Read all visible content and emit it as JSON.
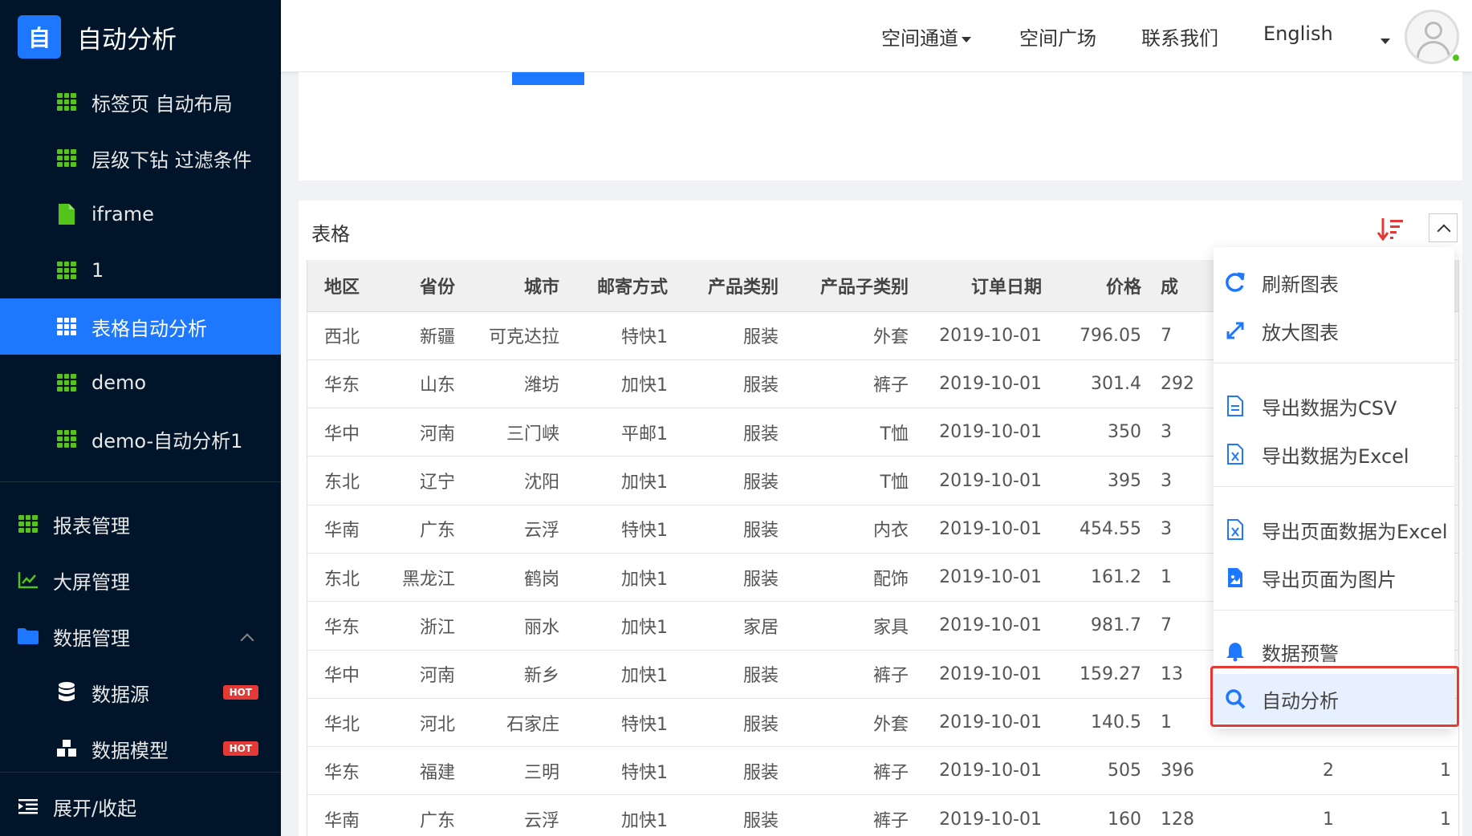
{
  "logo": {
    "glyph": "自",
    "title": "自动分析"
  },
  "sidebar": {
    "sub_items": [
      {
        "label": "标签页 自动布局",
        "icon": "grid-icon"
      },
      {
        "label": "层级下钻 过滤条件",
        "icon": "grid-icon"
      },
      {
        "label": "iframe",
        "icon": "file-icon"
      },
      {
        "label": "1",
        "icon": "grid-icon"
      },
      {
        "label": "表格自动分析",
        "icon": "grid-icon",
        "active": true
      },
      {
        "label": "demo",
        "icon": "grid-icon"
      },
      {
        "label": "demo-自动分析1",
        "icon": "grid-icon"
      }
    ],
    "top_items": [
      {
        "label": "报表管理",
        "icon": "grid-icon"
      },
      {
        "label": "大屏管理",
        "icon": "chart-line-icon"
      },
      {
        "label": "数据管理",
        "icon": "folder-icon"
      }
    ],
    "data_sub": [
      {
        "label": "数据源",
        "icon": "database-icon",
        "badge": "HOT"
      },
      {
        "label": "数据模型",
        "icon": "cubes-icon",
        "badge": "HOT"
      }
    ],
    "toggle": "展开/收起"
  },
  "header": {
    "nav": [
      "空间通道",
      "空间广场",
      "联系我们",
      "English"
    ]
  },
  "card": {
    "title": "表格"
  },
  "table": {
    "columns": [
      "地区",
      "省份",
      "城市",
      "邮寄方式",
      "产品类别",
      "产品子类别",
      "订单日期",
      "价格",
      "成",
      "",
      ""
    ],
    "rows": [
      [
        "西北",
        "新疆",
        "可克达拉",
        "特快1",
        "服装",
        "外套",
        "2019-10-01",
        "796.05",
        "7",
        "",
        ""
      ],
      [
        "华东",
        "山东",
        "潍坊",
        "加快1",
        "服装",
        "裤子",
        "2019-10-01",
        "301.4",
        "292",
        "",
        ""
      ],
      [
        "华中",
        "河南",
        "三门峡",
        "平邮1",
        "服装",
        "T恤",
        "2019-10-01",
        "350",
        "3",
        "",
        ""
      ],
      [
        "东北",
        "辽宁",
        "沈阳",
        "加快1",
        "服装",
        "T恤",
        "2019-10-01",
        "395",
        "3",
        "",
        ""
      ],
      [
        "华南",
        "广东",
        "云浮",
        "特快1",
        "服装",
        "内衣",
        "2019-10-01",
        "454.55",
        "3",
        "",
        ""
      ],
      [
        "东北",
        "黑龙江",
        "鹤岗",
        "加快1",
        "服装",
        "配饰",
        "2019-10-01",
        "161.2",
        "1",
        "",
        ""
      ],
      [
        "华东",
        "浙江",
        "丽水",
        "加快1",
        "家居",
        "家具",
        "2019-10-01",
        "981.7",
        "7",
        "",
        ""
      ],
      [
        "华中",
        "河南",
        "新乡",
        "加快1",
        "服装",
        "裤子",
        "2019-10-01",
        "159.27",
        "13",
        "",
        ""
      ],
      [
        "华北",
        "河北",
        "石家庄",
        "特快1",
        "服装",
        "外套",
        "2019-10-01",
        "140.5",
        "1",
        "",
        ""
      ],
      [
        "华东",
        "福建",
        "三明",
        "特快1",
        "服装",
        "裤子",
        "2019-10-01",
        "505",
        "396",
        "2",
        "1"
      ],
      [
        "华南",
        "广东",
        "云浮",
        "加快1",
        "服装",
        "裤子",
        "2019-10-01",
        "160",
        "128",
        "1",
        "1"
      ]
    ]
  },
  "dropdown": {
    "items": [
      {
        "label": "刷新图表",
        "icon": "refresh-icon"
      },
      {
        "label": "放大图表",
        "icon": "expand-icon"
      },
      {
        "label": "导出数据为CSV",
        "icon": "csv-file-icon"
      },
      {
        "label": "导出数据为Excel",
        "icon": "excel-file-icon"
      },
      {
        "label": "导出页面数据为Excel",
        "icon": "excel-file-icon"
      },
      {
        "label": "导出页面为图片",
        "icon": "image-file-icon"
      },
      {
        "label": "数据预警",
        "icon": "bell-icon"
      },
      {
        "label": "自动分析",
        "icon": "search-icon",
        "highlighted": true
      }
    ]
  },
  "colors": {
    "sidebar_bg": "#001529",
    "primary": "#1e78ff",
    "accent_green": "#52c41a",
    "highlight_red": "#e53935"
  }
}
